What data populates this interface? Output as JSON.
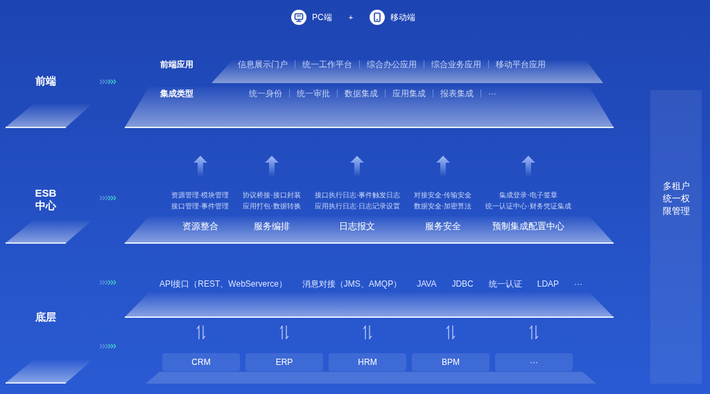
{
  "clients": [
    {
      "kind": "pc",
      "label": "PC端"
    },
    {
      "kind": "mobile",
      "label": "移动端"
    }
  ],
  "client_joiner": "+",
  "layer_labels": [
    {
      "lines": [
        "前端"
      ]
    },
    {
      "lines": [
        "ESB",
        "中心"
      ]
    },
    {
      "lines": [
        "底层"
      ]
    }
  ],
  "frontend": {
    "rows": [
      {
        "title": "前端应用",
        "items": [
          "信息展示门户",
          "统一工作平台",
          "综合办公应用",
          "综合业务应用",
          "移动平台应用"
        ]
      },
      {
        "title": "集成类型",
        "items": [
          "统一身份",
          "统一审批",
          "数据集成",
          "应用集成",
          "报表集成",
          "···"
        ]
      }
    ]
  },
  "esb": {
    "modules": [
      {
        "name": "资源整合",
        "details": [
          "资源管理·模块管理",
          "接口管理·事件管理"
        ]
      },
      {
        "name": "服务编排",
        "details": [
          "协议桥接·接口封装",
          "应用打包·数据转换"
        ]
      },
      {
        "name": "日志报文",
        "details": [
          "接口执行日志·事件触发日志",
          "应用执行日志·日志记录设置"
        ]
      },
      {
        "name": "服务安全",
        "details": [
          "对接安全·传输安全",
          "数据安全·加密算法"
        ]
      },
      {
        "name": "预制集成配置中心",
        "details": [
          "集成登录·电子签章",
          "统一认证中心·财务凭证集成"
        ]
      }
    ]
  },
  "base": {
    "protocols": [
      "API接口（REST、WebServerce）",
      "消息对接（JMS、AMQP）",
      "JAVA",
      "JDBC",
      "统一认证",
      "LDAP",
      "···"
    ],
    "systems": [
      "CRM",
      "ERP",
      "HRM",
      "BPM",
      "···"
    ]
  },
  "side_panel": {
    "lines": [
      "多租户",
      "统一权",
      "限管理"
    ]
  }
}
